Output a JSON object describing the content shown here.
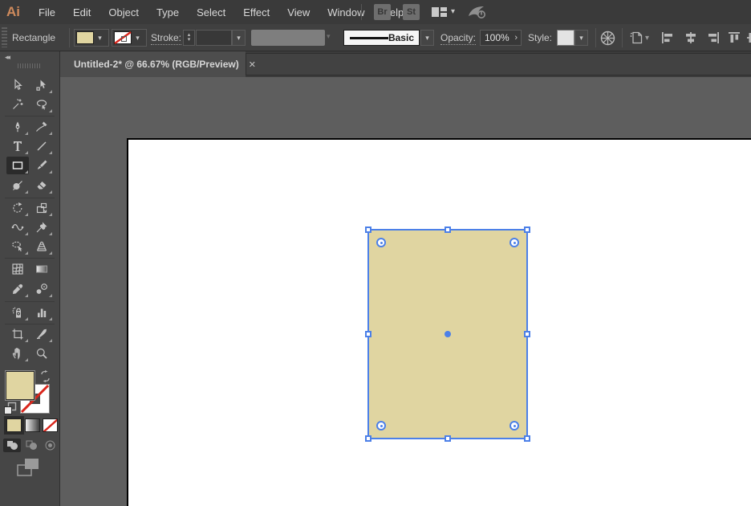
{
  "app": "Adobe Illustrator",
  "colors": {
    "fill_tan": "#E0D5A1",
    "selection_blue": "#4C80E8",
    "none_red": "#D9261C",
    "logo_orange": "#CE8A5C",
    "ui_dark": "#3A3A3A",
    "pasteboard": "#5E5E5E",
    "artboard": "#FFFFFF"
  },
  "menubar": {
    "logo": "Ai",
    "menus": [
      "File",
      "Edit",
      "Object",
      "Type",
      "Select",
      "Effect",
      "View",
      "Window",
      "Help"
    ],
    "bridge_button": "Br",
    "stock_button": "St",
    "icons": [
      "workspace-switcher-icon",
      "cc-sync-icon"
    ]
  },
  "control_bar": {
    "context_label": "Rectangle",
    "fill_swatch_color": "#E0D5A1",
    "stroke_swatch": "none",
    "stroke_label": "Stroke:",
    "stroke_value": "",
    "brush_name": "Basic",
    "opacity_label": "Opacity:",
    "opacity_value": "100%",
    "style_label": "Style:",
    "icons": [
      "recolor-artwork-icon",
      "shape-props-icon",
      "align-left-icon",
      "align-center-icon",
      "align-right-icon",
      "align-top-icon",
      "align-vcenter-icon"
    ]
  },
  "tab_bar": {
    "tabs": [
      {
        "title": "Untitled-2* @ 66.67% (RGB/Preview)",
        "close_glyph": "✕",
        "active": true
      }
    ]
  },
  "toolbar": {
    "collapse_glyph": "◂◂",
    "tools": [
      "selection",
      "direct-selection",
      "magic-wand",
      "lasso",
      "pen",
      "curvature",
      "type",
      "line-segment",
      "rectangle",
      "paintbrush",
      "shaper",
      "eraser",
      "rotate",
      "scale",
      "width",
      "puppet-warp",
      "shape-builder",
      "perspective-grid",
      "mesh",
      "gradient",
      "eyedropper",
      "blend",
      "symbol-sprayer",
      "column-graph",
      "artboard",
      "slice",
      "hand",
      "zoom"
    ],
    "active_tool": "rectangle",
    "fill_color": "#E0D5A1",
    "stroke_color": "none",
    "color_mode_buttons": [
      "color",
      "gradient",
      "none"
    ],
    "draw_mode_buttons": [
      "draw-normal",
      "draw-behind",
      "draw-inside"
    ],
    "active_draw_mode": "draw-normal"
  },
  "canvas": {
    "zoom": "66.67%",
    "selected_shape": {
      "type": "rectangle",
      "fill": "#E0D5A1",
      "stroke": "none",
      "handles": 8,
      "corner_widgets": 4
    }
  }
}
